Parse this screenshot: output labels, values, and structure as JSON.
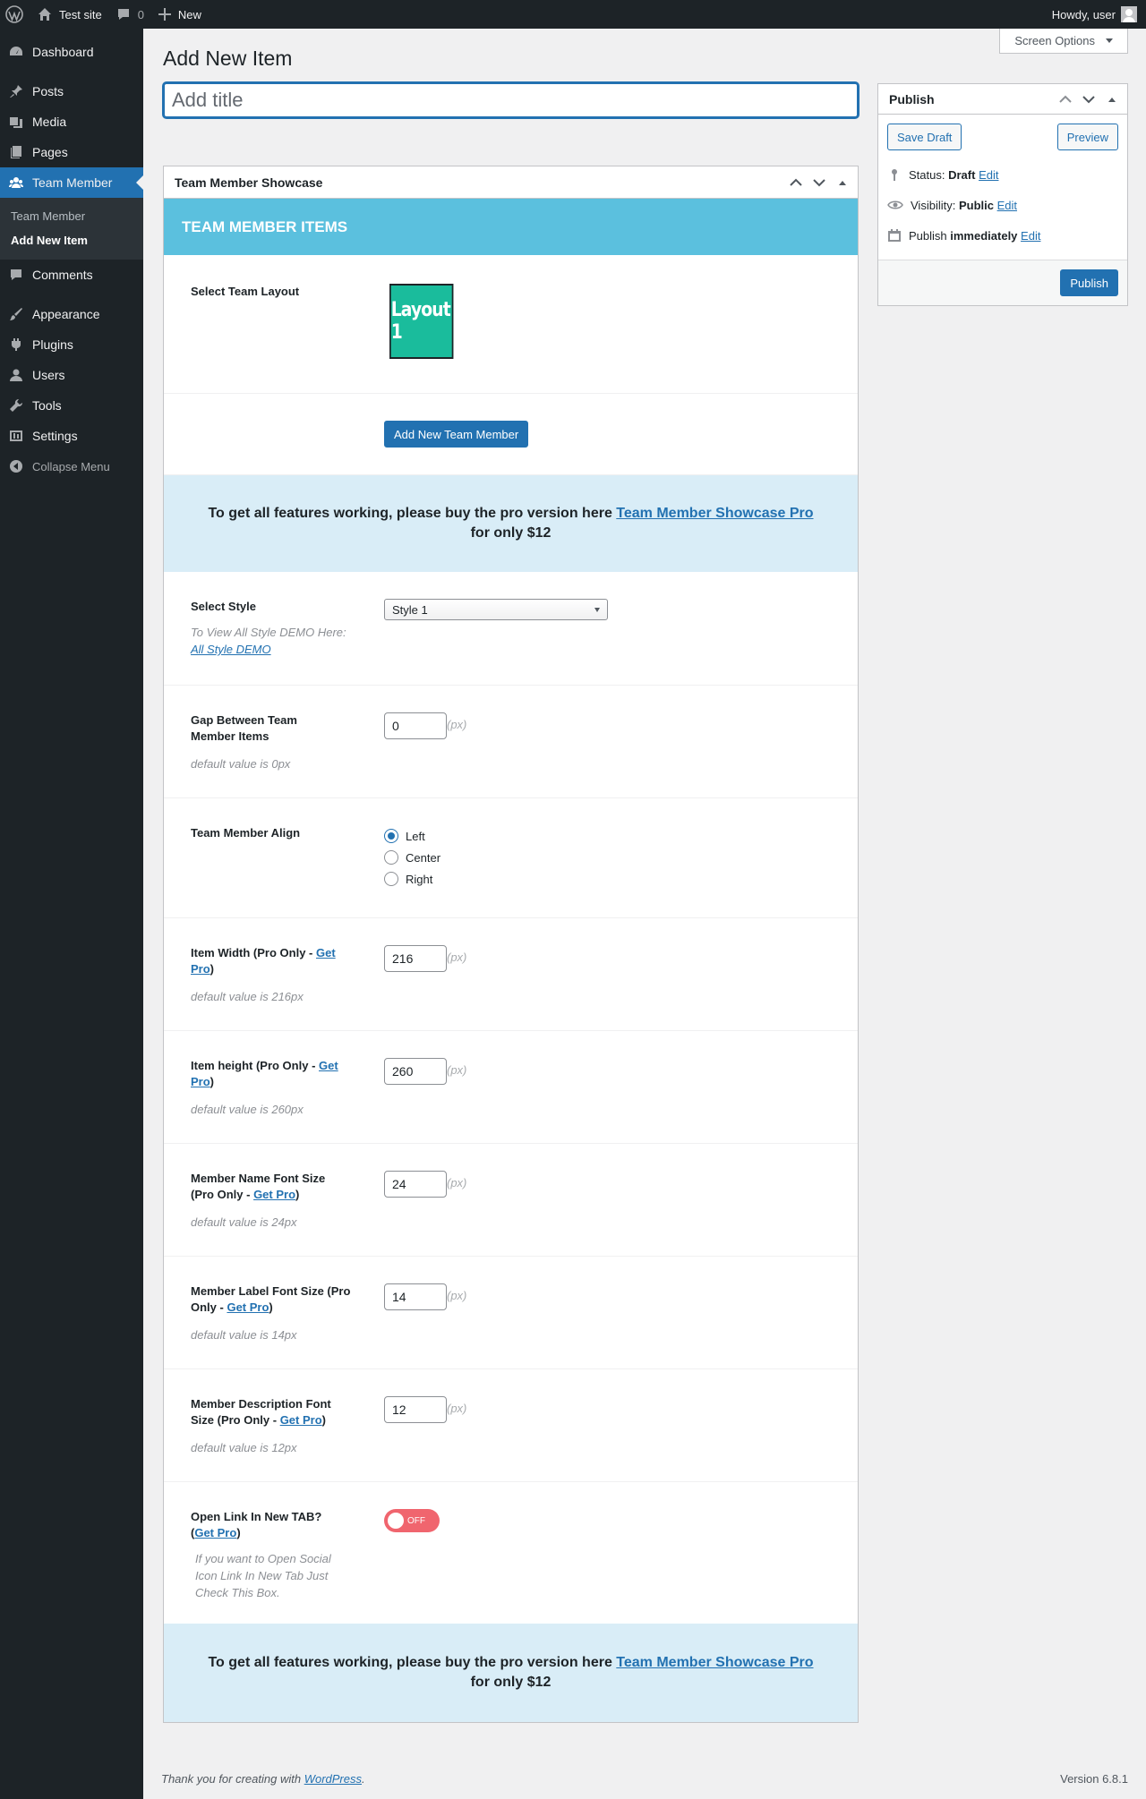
{
  "adminbar": {
    "site_name": "Test site",
    "comments_count": "0",
    "new_label": "New",
    "howdy": "Howdy, user"
  },
  "sidebar": {
    "items": [
      {
        "label": "Dashboard",
        "icon": "dashboard-icon"
      },
      {
        "label": "Posts",
        "icon": "pin-icon"
      },
      {
        "label": "Media",
        "icon": "media-icon"
      },
      {
        "label": "Pages",
        "icon": "pages-icon"
      },
      {
        "label": "Team Member",
        "icon": "team-icon",
        "current": true
      },
      {
        "label": "Comments",
        "icon": "comments-icon"
      },
      {
        "label": "Appearance",
        "icon": "appearance-icon"
      },
      {
        "label": "Plugins",
        "icon": "plugins-icon"
      },
      {
        "label": "Users",
        "icon": "users-icon"
      },
      {
        "label": "Tools",
        "icon": "tools-icon"
      },
      {
        "label": "Settings",
        "icon": "settings-icon"
      }
    ],
    "submenu": [
      "Team Member",
      "Add New Item"
    ],
    "collapse": "Collapse Menu"
  },
  "header": {
    "screen_options": "Screen Options",
    "page_title": "Add New Item",
    "title_placeholder": "Add title"
  },
  "metabox": {
    "title": "Team Member Showcase",
    "section_title": "TEAM MEMBER ITEMS",
    "layout_label": "Select Team Layout",
    "layout_thumb": "Layout 1",
    "add_member_button": "Add New Team Member",
    "promo_text": "To get all features working, please buy the pro version here",
    "promo_link": "Team Member Showcase Pro",
    "promo_suffix": "for only $12",
    "style": {
      "label": "Select Style",
      "hint": "To View All Style DEMO Here:",
      "hint_link": "All Style DEMO",
      "value": "Style 1"
    },
    "gap": {
      "label": "Gap Between Team Member Items",
      "value": "0",
      "unit": "(px)",
      "hint": "default value is 0px"
    },
    "align": {
      "label": "Team Member Align",
      "options": [
        "Left",
        "Center",
        "Right"
      ],
      "selected": "Left"
    },
    "item_width": {
      "label": "Item Width (Pro Only - ",
      "link": "Get Pro",
      "close": ")",
      "value": "216",
      "unit": "(px)",
      "hint": "default value is 216px"
    },
    "item_height": {
      "label": "Item height (Pro Only - ",
      "link": "Get Pro",
      "close": ")",
      "value": "260",
      "unit": "(px)",
      "hint": "default value is 260px"
    },
    "name_font": {
      "label": "Member Name Font Size (Pro Only - ",
      "link": "Get Pro",
      "close": ")",
      "value": "24",
      "unit": "(px)",
      "hint": "default value is 24px"
    },
    "label_font": {
      "label": "Member Label Font Size (Pro Only - ",
      "link": "Get Pro",
      "close": ")",
      "value": "14",
      "unit": "(px)",
      "hint": "default value is 14px"
    },
    "desc_font": {
      "label": "Member Description Font Size (Pro Only - ",
      "link": "Get Pro",
      "close": ")",
      "value": "12",
      "unit": "(px)",
      "hint": "default value is 12px"
    },
    "new_tab": {
      "label": "Open Link In New TAB? (",
      "link": "Get Pro",
      "close": ")",
      "hint": "If you want to Open Social Icon Link In New Tab Just Check This Box.",
      "toggle": "OFF"
    }
  },
  "publish": {
    "title": "Publish",
    "save_draft": "Save Draft",
    "preview": "Preview",
    "status_label": "Status:",
    "status_value": "Draft",
    "visibility_label": "Visibility:",
    "visibility_value": "Public",
    "publish_label": "Publish",
    "publish_value": "immediately",
    "edit": "Edit",
    "publish_button": "Publish"
  },
  "footer": {
    "text": "Thank you for creating with",
    "link": "WordPress",
    "period": ".",
    "version": "Version 6.8.1"
  },
  "colors": {
    "accent": "#2271b1",
    "sidebar_bg": "#1d2327",
    "section_header": "#5bc0de",
    "promo_bg": "#d9edf7",
    "layout_thumb": "#1abc9c",
    "toggle_off": "#f0656e"
  }
}
